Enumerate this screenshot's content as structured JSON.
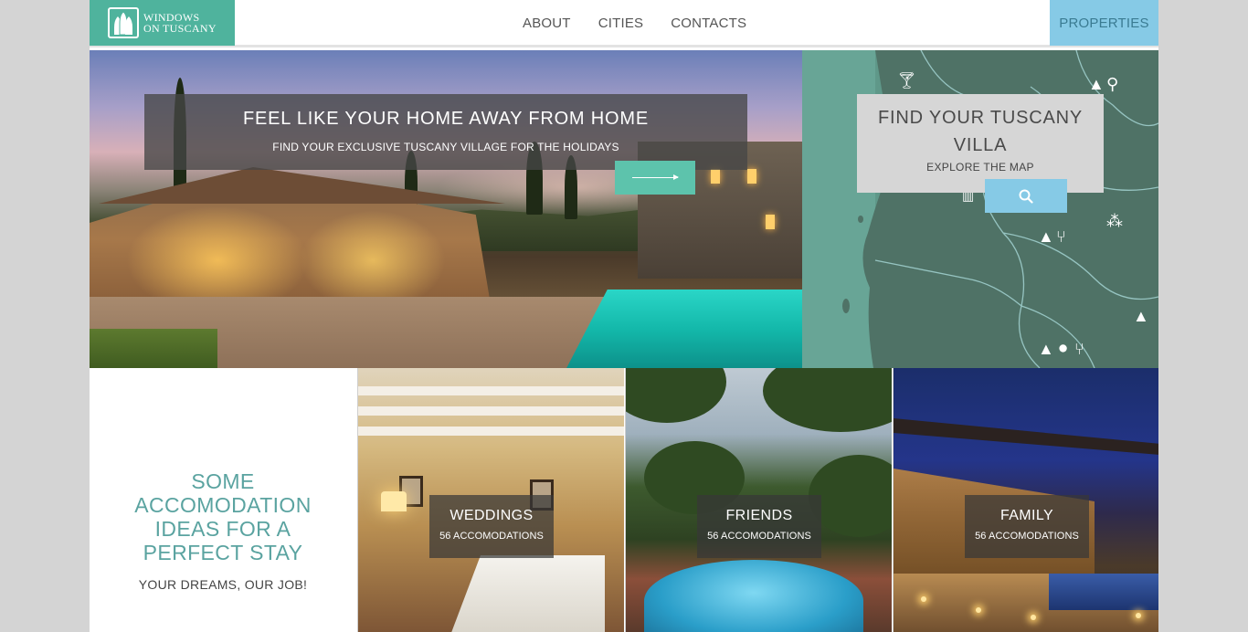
{
  "header": {
    "logo_line1": "WINDOWS",
    "logo_line2": "ON TUSCANY",
    "nav": [
      "ABOUT",
      "CITIES",
      "CONTACTS"
    ],
    "properties_label": "PROPERTIES"
  },
  "hero": {
    "title": "FEEL LIKE YOUR HOME AWAY FROM HOME",
    "subtitle": "FIND YOUR EXCLUSIVE TUSCANY VILLAGE FOR THE HOLIDAYS",
    "arrow_icon": "arrow-right-icon"
  },
  "map": {
    "title": "FIND YOUR TUSCANY VILLA",
    "subtitle": "EXPLORE THE MAP",
    "search_icon": "search-icon",
    "icons": [
      "cocktail-icon",
      "tree-icon",
      "cycling-icon",
      "columns-icon",
      "grapes-icon",
      "tree-icon",
      "fork-knife-icon",
      "tree-icon",
      "spa-stones-icon",
      "fork-knife-icon"
    ]
  },
  "ideas": {
    "title": "SOME ACCOMODATION IDEAS FOR A PERFECT STAY",
    "subtitle": "YOUR DREAMS, OUR JOB!"
  },
  "cards": [
    {
      "title": "WEDDINGS",
      "count": "56 ACCOMODATIONS"
    },
    {
      "title": "FRIENDS",
      "count": "56 ACCOMODATIONS"
    },
    {
      "title": "FAMILY",
      "count": "56 ACCOMODATIONS"
    }
  ],
  "colors": {
    "brand_green": "#4fb39d",
    "accent_teal": "#5dc3ac",
    "accent_blue": "#86cae6",
    "map_green": "#5f9889",
    "ideas_text": "#5aa3a0"
  }
}
